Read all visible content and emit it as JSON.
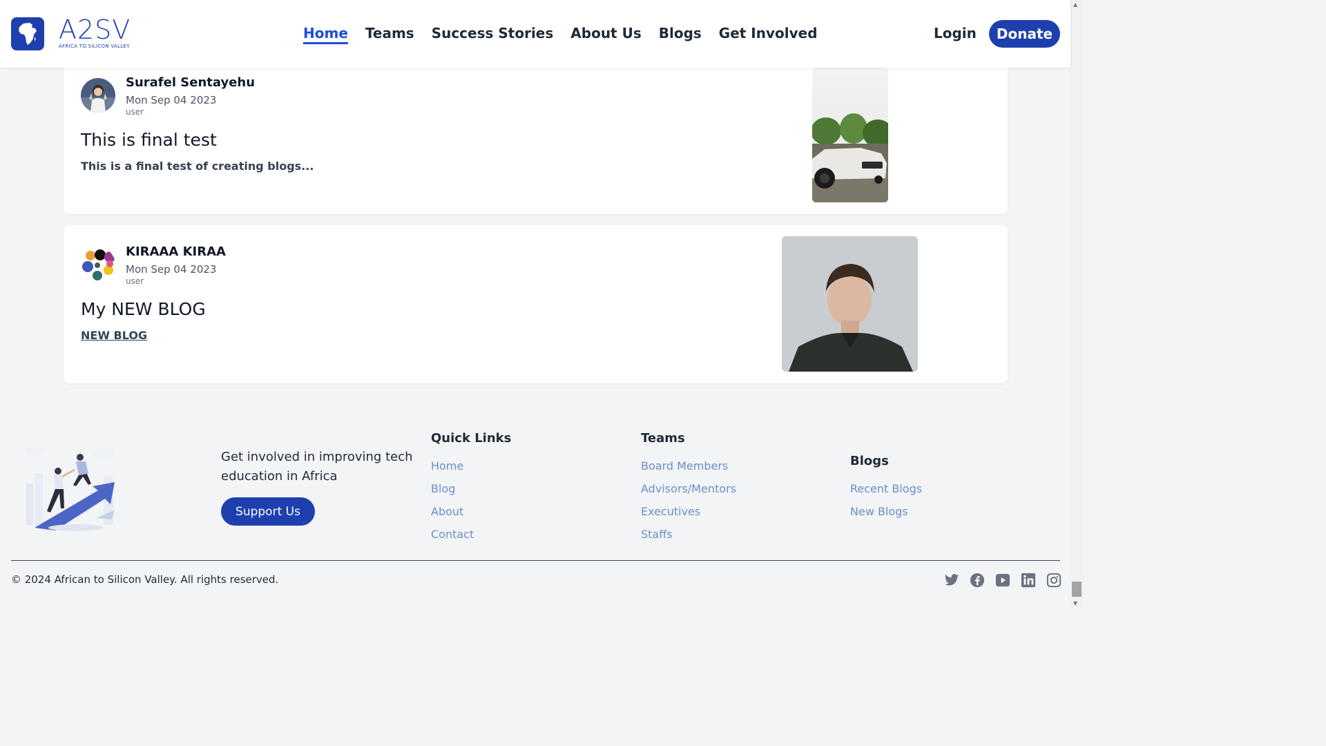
{
  "header": {
    "logo_text": "A2SV",
    "logo_subtext": "AFRICA TO SILICON VALLEY",
    "nav": [
      {
        "label": "Home",
        "active": true
      },
      {
        "label": "Teams"
      },
      {
        "label": "Success Stories"
      },
      {
        "label": "About Us"
      },
      {
        "label": "Blogs"
      },
      {
        "label": "Get Involved"
      }
    ],
    "login_label": "Login",
    "donate_label": "Donate"
  },
  "posts": [
    {
      "author": "Surafel Sentayehu",
      "date": "Mon Sep 04 2023",
      "role": "user",
      "title": "This is final test",
      "excerpt": "This is a final test of creating blogs..."
    },
    {
      "author": "KIRAAA KIRAA",
      "date": "Mon Sep 04 2023",
      "role": "user",
      "title": "My NEW BLOG",
      "excerpt": "NEW BLOG"
    }
  ],
  "footer": {
    "cta_text": "Get involved in improving tech education in Africa",
    "support_label": "Support Us",
    "quick_links": {
      "title": "Quick Links",
      "items": [
        "Home",
        "Blog",
        "About",
        "Contact"
      ]
    },
    "teams": {
      "title": "Teams",
      "items": [
        "Board Members",
        "Advisors/Mentors",
        "Executives",
        "Staffs"
      ]
    },
    "blogs": {
      "title": "Blogs",
      "items": [
        "Recent Blogs",
        "New Blogs"
      ]
    },
    "copyright": "© 2024 African to Silicon Valley. All rights reserved.",
    "socials": [
      "twitter-icon",
      "facebook-icon",
      "youtube-icon",
      "linkedin-icon",
      "instagram-icon"
    ]
  },
  "colors": {
    "brand": "#1e40af",
    "link": "#6b8ec9",
    "background": "#f3f4f6"
  }
}
